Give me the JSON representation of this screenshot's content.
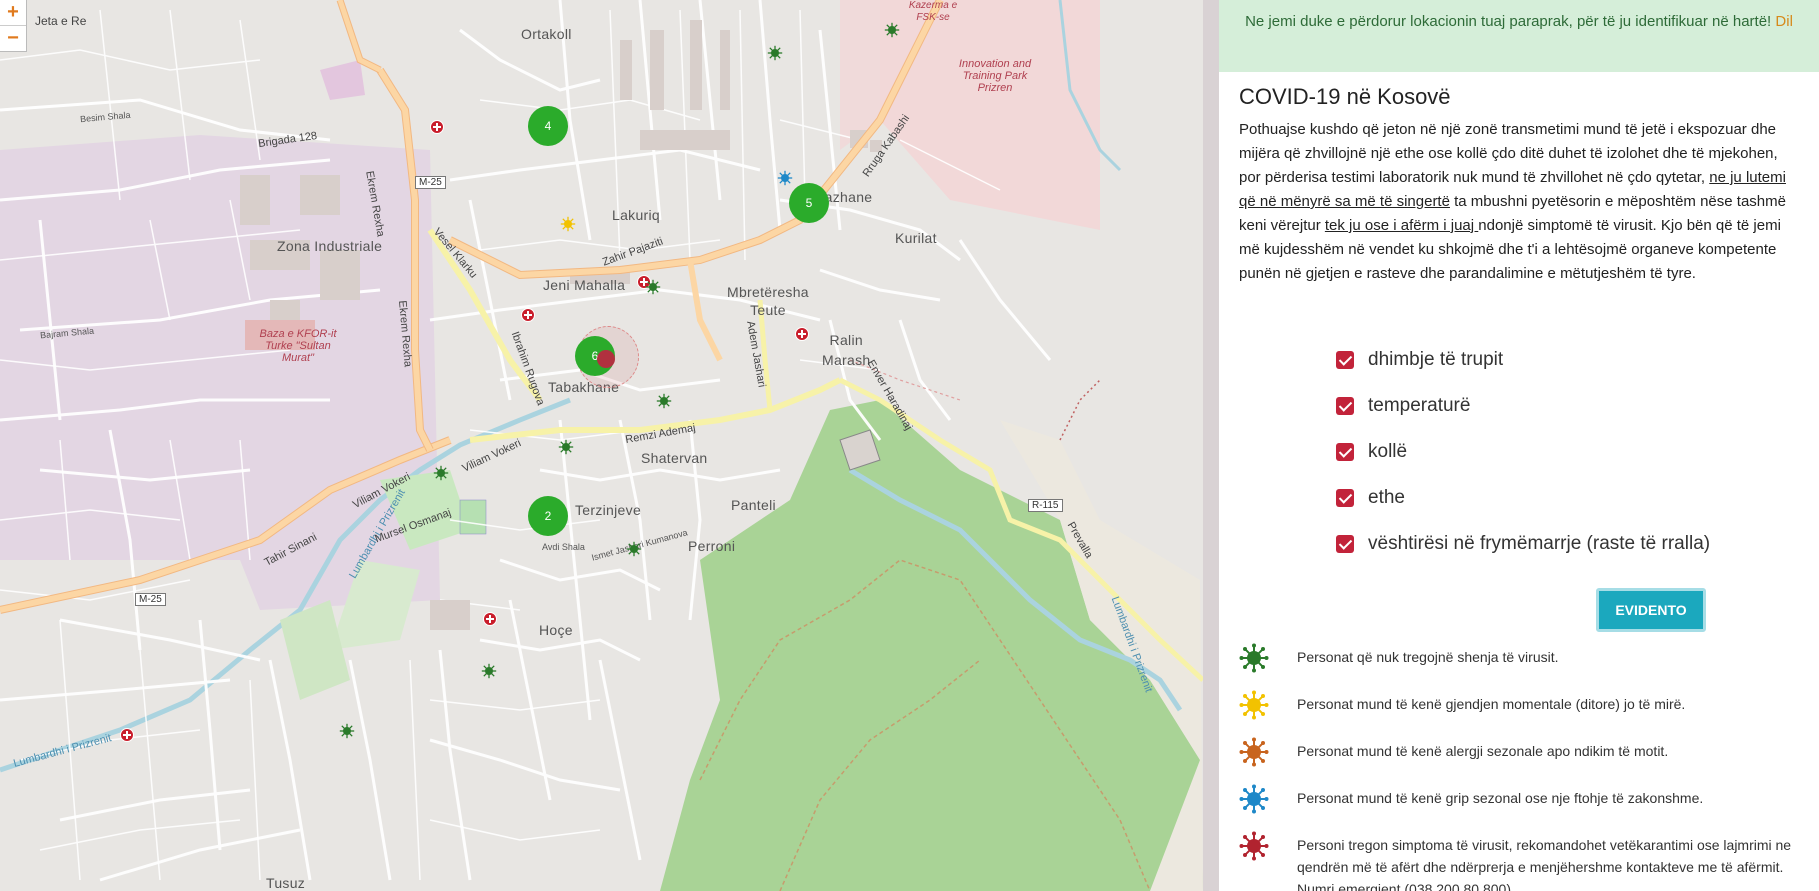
{
  "map": {
    "zoom_in": "+",
    "zoom_out": "−",
    "labels": {
      "jeta_e_re": "Jeta e Re",
      "ortakoll": "Ortakoll",
      "lakuriq": "Lakuriq",
      "zona_industriale": "Zona Industriale",
      "jeni_mahalla": "Jeni Mahalla",
      "mbretëresha_teute": "Mbretëresha\nTeute",
      "ralin_marash": "Ralin\nMarash",
      "tabakhane": "Tabakhane",
      "shatervan": "Shatervan",
      "panteli": "Panteli",
      "terzinjeve": "Terzinjeve",
      "perroni": "Perroni",
      "hoçe": "Hoçe",
      "tusuz": "Tusuz",
      "bajrakli_kurilat": "Kurilat",
      "bazhane": "Bazhane",
      "innovation_park": "Innovation and Training Park Prizren",
      "kfor": "Baza e KFOR-it Turke \"Sultan Murat\"",
      "kazerma": "Kazerma e FSK-se",
      "m25_a": "M-25",
      "m25_b": "M-25",
      "r115": "R-115",
      "zahir_pajaziti": "Zahir Pajaziti",
      "ekrem_rexha": "Ekrem Rexha",
      "vesel_klarku": "Vesel Klarku",
      "ibrahim_rugova": "Ibrahim Rugova",
      "viliam_vokeri": "Viliam Vokeri",
      "tahir_sinani": "Tahir Sinani",
      "remzi_ademaj": "Remzi Ademaj",
      "lumbardhi_a": "Lumbardhi i Prizrenit",
      "lumbardhi_b": "Lumbardhi i Prizrenit",
      "lumbardhi_c": "Lumbardhi i Prizrenit",
      "prevalla": "Prevalla",
      "brigada_128": "Brigada 128",
      "enver_haradinaj": "Enver Haradinaj",
      "adem_jashari": "Adem Jashari",
      "besim_shala": "Besim Shala",
      "bajram_shala": "Bajram Shala",
      "mursel_osmanaj": "Mursel Osmanaj",
      "ismet_jashari": "Ismet Jashari Kumanova",
      "avdi_shala": "Avdi Shala",
      "rruga_kabashi": "Rruga Kabashi"
    },
    "clusters": [
      {
        "id": "c4",
        "count": "4"
      },
      {
        "id": "c5",
        "count": "5"
      },
      {
        "id": "c6",
        "count": "6"
      },
      {
        "id": "c2",
        "count": "2"
      }
    ]
  },
  "panel": {
    "alert_text": "Ne jemi duke e përdorur lokacionin tuaj paraprak, për të ju identifikuar në hartë!",
    "alert_link": "Dil",
    "title": "COVID-19 në Kosovë",
    "intro_1": "Pothuajse kushdo që jeton në një zonë transmetimi mund të jetë i ekspozuar dhe mijëra që zhvillojnë një ethe ose kollë çdo ditë duhet të izolohet dhe të mjekohen, por përderisa testimi laboratorik nuk mund të zhvillohet në çdo qytetar, ",
    "intro_u1": "ne ju lutemi që në mënyrë sa më të singertë",
    "intro_2": " ta mbushni pyetësorin e mëposhtëm nëse tashmë keni vërejtur ",
    "intro_u2": "tek ju ose i afërm i juaj ",
    "intro_3": "ndonjë simptomë të virusit. Kjo bën që të jemi më kujdesshëm në vendet ku shkojmë dhe t'i a lehtësojmë organeve kompetente punën në gjetjen e rasteve dhe parandalimine e mëtutjeshëm të tyre.",
    "symptoms": [
      {
        "label": "dhimbje të trupit",
        "checked": true
      },
      {
        "label": "temperaturë",
        "checked": true
      },
      {
        "label": "kollë",
        "checked": true
      },
      {
        "label": "ethe",
        "checked": true
      },
      {
        "label": "vështirësi në frymëmarrje (raste të rralla)",
        "checked": true
      }
    ],
    "button_label": "EVIDENTO",
    "legend": [
      {
        "icon": "virus-green-icon",
        "color": "#2a7a2a",
        "text": "Personat që nuk tregojnë shenja të virusit."
      },
      {
        "icon": "virus-yellow-icon",
        "color": "#f2c200",
        "text": "Personat mund të kenë gjendjen momentale (ditore) jo të mirë."
      },
      {
        "icon": "virus-orange-icon",
        "color": "#c8641e",
        "text": "Personat mund të kenë alergji sezonale apo ndikim të motit."
      },
      {
        "icon": "virus-blue-icon",
        "color": "#1e88c8",
        "text": "Personat mund të kenë grip sezonal ose nje ftohje të zakonshme."
      },
      {
        "icon": "virus-red-icon",
        "color": "#b1232f",
        "text": "Personi tregon simptoma të virusit, rekomandohet vetëkarantimi ose lajmrimi ne qendrën më të afërt dhe ndërprerja e menjëhershme kontakteve me të afërmit. Numri emergjent (038 200 80 800)"
      }
    ]
  }
}
